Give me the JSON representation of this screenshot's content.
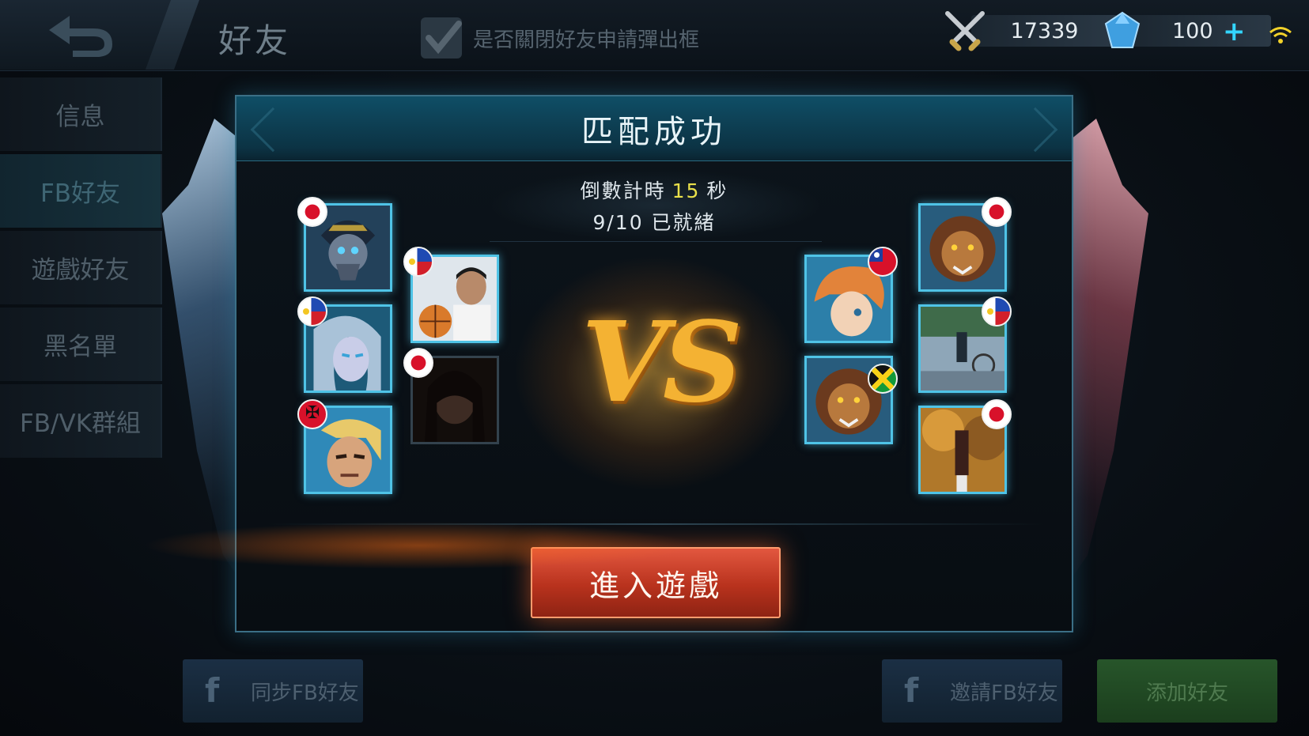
{
  "header": {
    "title": "好友",
    "popup_toggle_label": "是否關閉好友申請彈出框",
    "gold_amount": "17339",
    "diamond_amount": "100",
    "plus_label": "+"
  },
  "sidebar": {
    "items": [
      {
        "label": "信息"
      },
      {
        "label": "FB好友"
      },
      {
        "label": "遊戲好友"
      },
      {
        "label": "黑名單"
      },
      {
        "label": "FB/VK群組"
      }
    ],
    "active_index": 1
  },
  "match": {
    "title": "匹配成功",
    "countdown_prefix": "倒數計時",
    "countdown_value": "15",
    "countdown_suffix": "秒",
    "ready_status": "9/10 已就緒",
    "vs_label": "VS",
    "enter_button": "進入遊戲",
    "team_left": [
      {
        "avatar": "undead-hero",
        "flag": "japan",
        "ready": true
      },
      {
        "avatar": "elf-hero",
        "flag": "philippines",
        "ready": true
      },
      {
        "avatar": "blond-warrior",
        "flag": "albania",
        "ready": true
      },
      {
        "avatar": "photo-boy-basketball",
        "flag": "philippines",
        "ready": true
      },
      {
        "avatar": "photo-girl",
        "flag": "japan",
        "ready": false
      }
    ],
    "team_right": [
      {
        "avatar": "lion-hero",
        "flag": "japan",
        "ready": true
      },
      {
        "avatar": "photo-bikes",
        "flag": "philippines",
        "ready": true
      },
      {
        "avatar": "photo-autumn",
        "flag": "japan",
        "ready": true
      },
      {
        "avatar": "orange-hair-hero",
        "flag": "taiwan",
        "ready": true
      },
      {
        "avatar": "lion-hero",
        "flag": "jamaica",
        "ready": true
      }
    ]
  },
  "footer": {
    "sync_fb": "同步FB好友",
    "invite_fb": "邀請FB好友",
    "add_friend": "添加好友",
    "fb_icon_glyph": "f"
  },
  "colors": {
    "accent": "#4fc3e6",
    "enter_button": "#b8321d",
    "countdown_number": "#e9e04a",
    "vs_gold": "#f4b233"
  }
}
